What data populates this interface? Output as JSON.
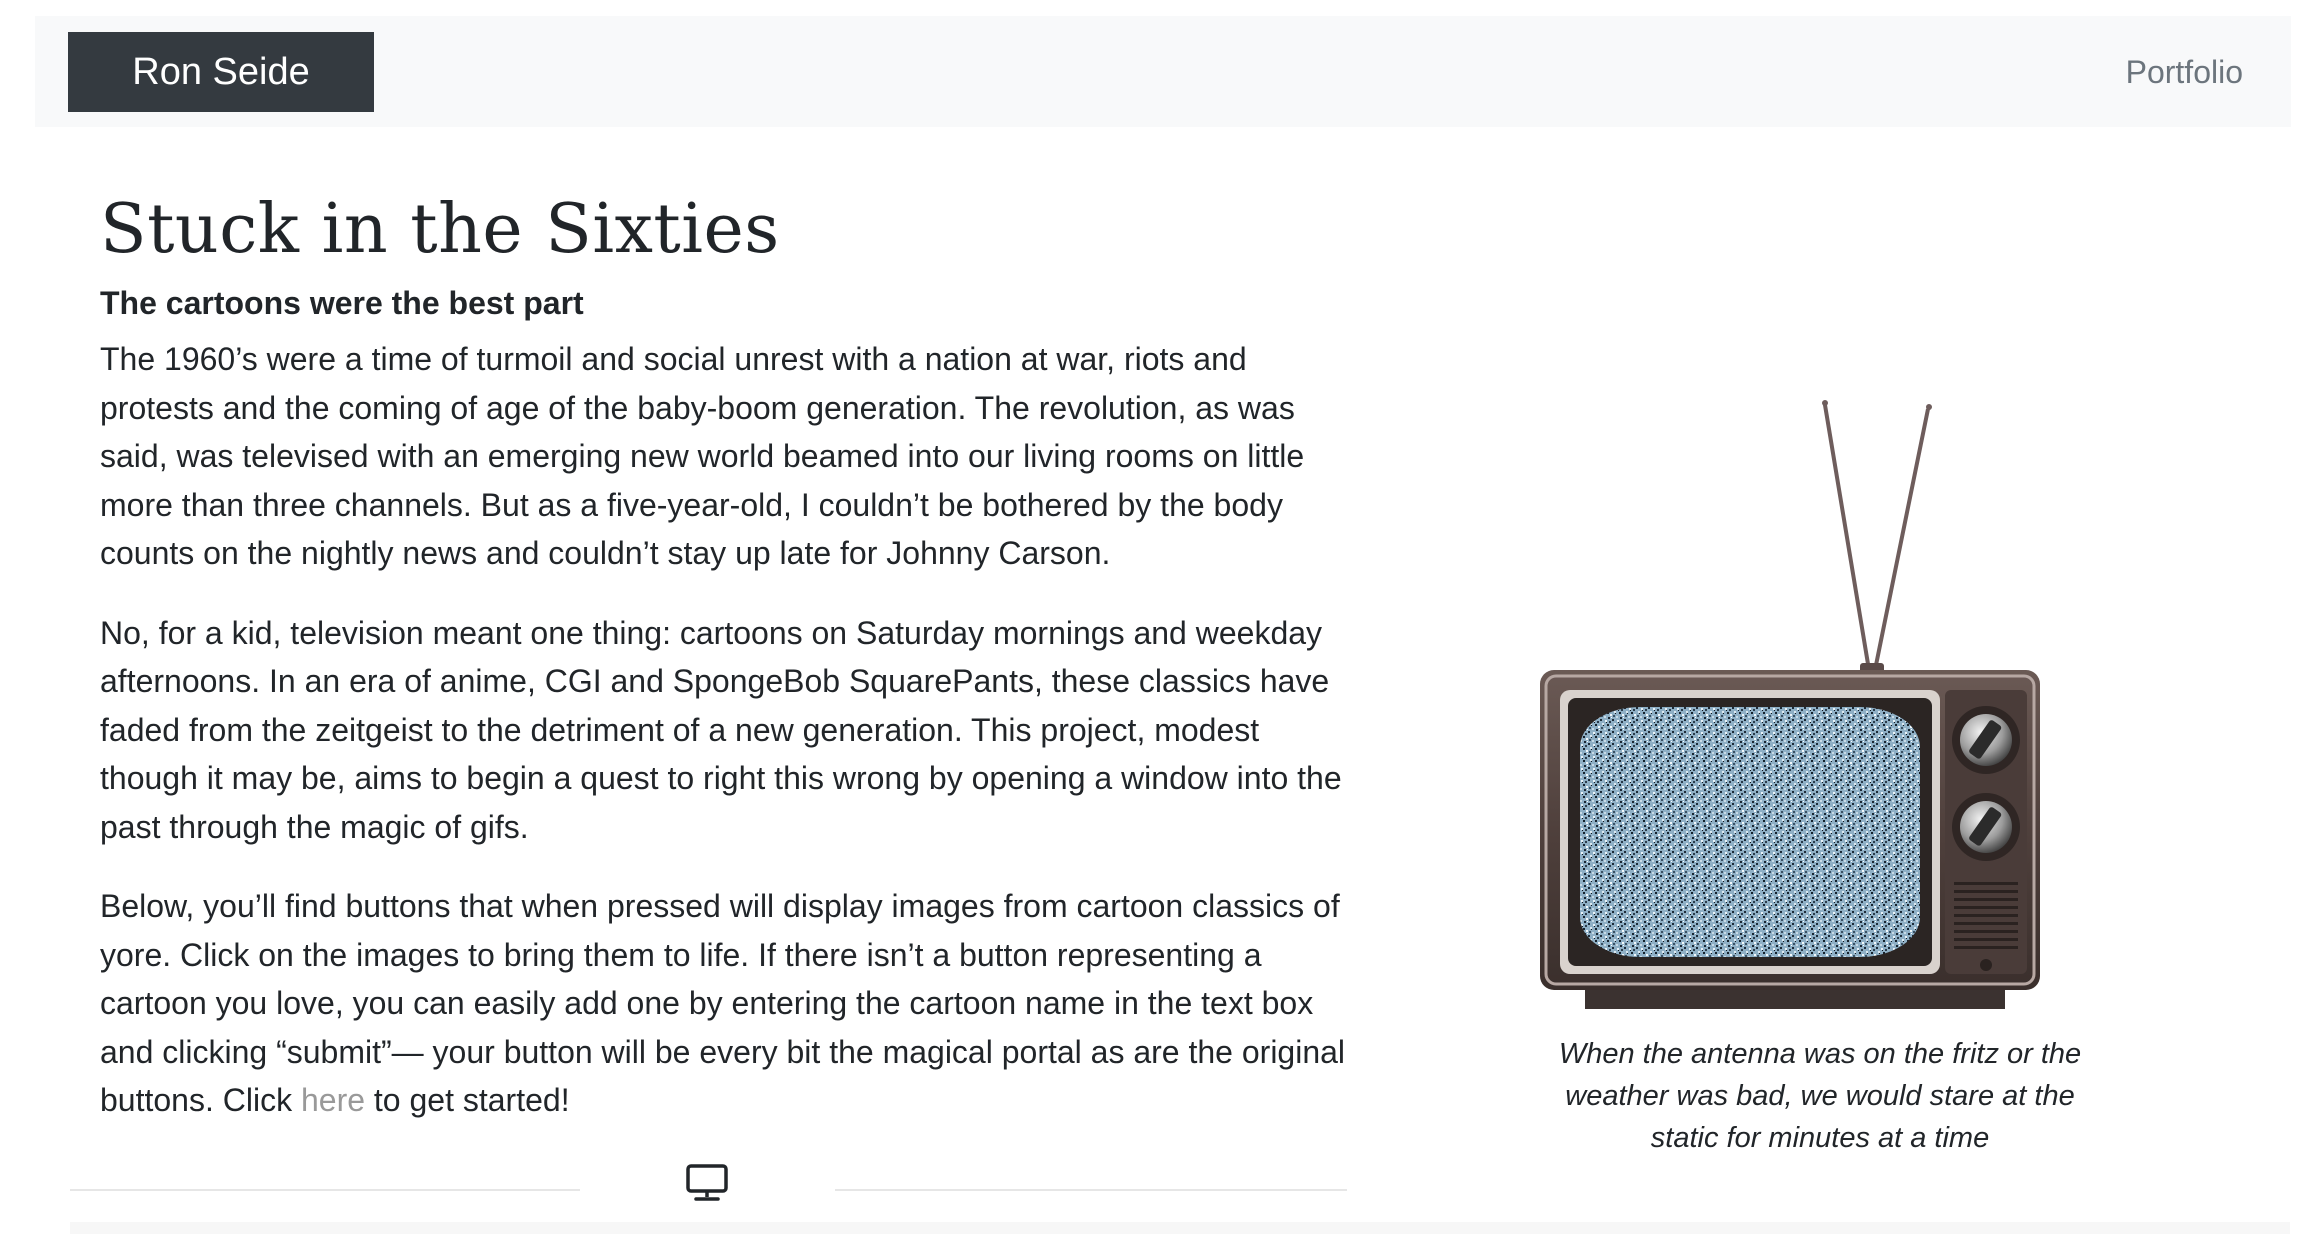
{
  "navbar": {
    "brand": "Ron Seide",
    "links": [
      "Portfolio"
    ]
  },
  "main": {
    "title": "Stuck in the Sixties",
    "subtitle": "The cartoons were the best part",
    "paragraphs": [
      "The 1960’s were a time of turmoil and social unrest with a nation at war, riots and protests and the coming of age of the baby-boom generation. The revolution, as was said, was televised with an emerging new world beamed into our living rooms on little more than three channels. But as a five-year-old, I couldn’t be bothered by the body counts on the nightly news and couldn’t stay up late for Johnny Carson.",
      "No, for a kid, television meant one thing: cartoons on Saturday mornings and weekday afternoons. In an era of anime, CGI and SpongeBob SquarePants, these classics have faded from the zeitgeist to the detriment of a new generation. This project, modest though it may be, aims to begin a quest to right this wrong by opening a window into the past through the magic of gifs."
    ],
    "paragraph3": {
      "before": "Below, you’ll find buttons that when pressed will display images from cartoon classics of yore. Click on the images to bring them to life. If there isn’t a button representing a cartoon you love, you can easily add one by entering the cartoon name in the text box and clicking “submit”— your button will be every bit the magical portal as are the original buttons. Click ",
      "link": "here",
      "after": " to get started!"
    }
  },
  "figure": {
    "image": "retro-tv-static-icon",
    "caption": "When the antenna was on the fritz or the weather was bad, we would stare at the static for minutes at a time"
  },
  "divider": {
    "icon": "tv-monitor-icon"
  },
  "colors": {
    "navbar_bg": "#f8f9fa",
    "brand_bg": "#343a40",
    "text": "#212529",
    "muted_link": "#999999"
  }
}
